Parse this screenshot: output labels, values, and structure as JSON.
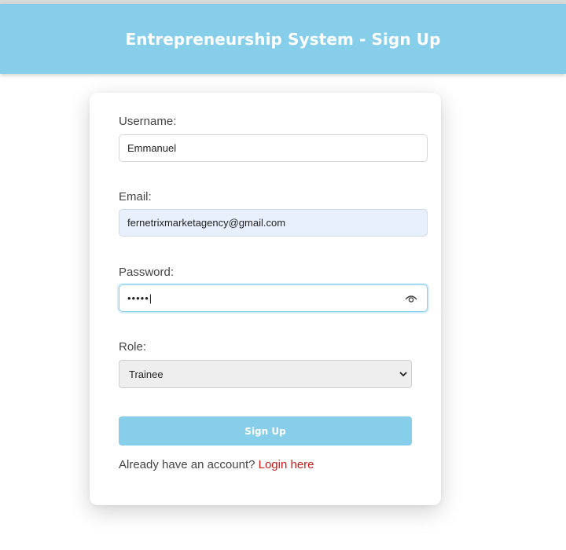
{
  "header": {
    "title": "Entrepreneurship System - Sign Up"
  },
  "form": {
    "username": {
      "label": "Username:",
      "value": "Emmanuel"
    },
    "email": {
      "label": "Email:",
      "value": "fernetrixmarketagency@gmail.com"
    },
    "password": {
      "label": "Password:",
      "masked_value": "•••••|",
      "toggle_icon": "eye-icon"
    },
    "role": {
      "label": "Role:",
      "selected": "Trainee"
    },
    "submit_label": "Sign Up",
    "footer": {
      "prompt": "Already have an account?",
      "link_label": "Login here"
    }
  },
  "colors": {
    "accent": "#87ceeb",
    "link": "#cc1a1a",
    "autofill_bg": "#e8f0fe"
  }
}
